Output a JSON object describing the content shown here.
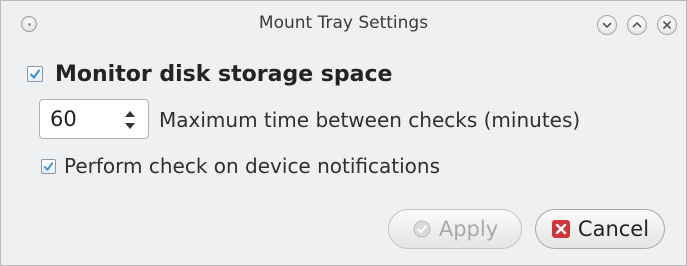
{
  "window": {
    "title": "Mount Tray Settings"
  },
  "settings": {
    "monitor_label": "Monitor disk storage space",
    "monitor_checked": true,
    "interval_value": "60",
    "interval_label": "Maximum time between checks (minutes)",
    "notify_label": "Perform check on device notifications",
    "notify_checked": true
  },
  "buttons": {
    "apply_label": "Apply",
    "apply_enabled": false,
    "cancel_label": "Cancel"
  },
  "icons": {
    "app": "app-menu-icon",
    "minimize": "chevron-down-icon",
    "maximize": "chevron-up-icon",
    "close": "close-icon",
    "apply": "checkmark-icon",
    "cancel": "cancel-x-icon"
  },
  "colors": {
    "window_bg": "#eff0f1",
    "checkmark": "#3b8fd6",
    "cancel_icon": "#d0353b",
    "disabled_text": "#a9a9a9"
  }
}
